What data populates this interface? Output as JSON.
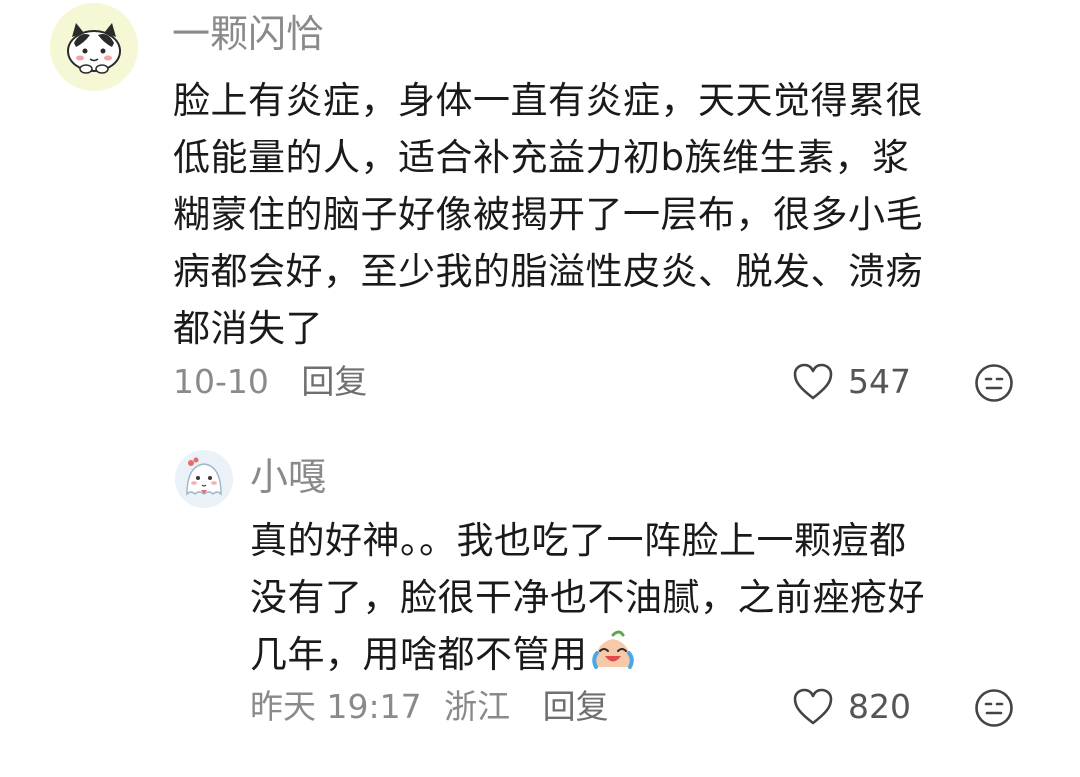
{
  "comments": [
    {
      "username": "一颗闪恰",
      "lines": [
        "脸上有炎症，身体一直有炎症，天天觉得累很",
        "低能量的人，适合补充益力初b族维生素，浆",
        "糊蒙住的脑子好像被揭开了一层布，很多小毛",
        "病都会好，至少我的脂溢性皮炎、脱发、溃疡",
        "都消失了"
      ],
      "date": "10-10",
      "reply_label": "回复",
      "like_count": "547",
      "avatar_icon": "cat-avatar-icon"
    },
    {
      "username": "小嘎",
      "lines": [
        "真的好神。。我也吃了一阵脸上一颗痘都",
        "没有了，脸很干净也不油腻，之前痤疮好",
        "几年，用啥都不管用"
      ],
      "trailing_emoji": "crying-laugh-emoji",
      "date": "昨天 19:17",
      "location": "浙江",
      "reply_label": "回复",
      "like_count": "820",
      "avatar_icon": "ghost-avatar-icon"
    }
  ],
  "colors": {
    "text": "#1a1a1a",
    "meta": "#8a8a8a",
    "icon": "#444444"
  }
}
